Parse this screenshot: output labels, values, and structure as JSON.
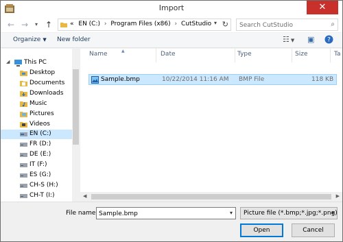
{
  "window": {
    "title": "Import",
    "close_glyph": "✕"
  },
  "navigation": {
    "back_icon": "arrow-left-icon",
    "forward_icon": "arrow-right-icon",
    "up_icon": "arrow-up-icon",
    "breadcrumb": {
      "overflow": "«",
      "parts": [
        "EN (C:)",
        "Program Files (x86)",
        "CutStudio"
      ],
      "separator": "›"
    },
    "search_placeholder": "Search CutStudio"
  },
  "toolbar": {
    "organize_label": "Organize",
    "new_folder_label": "New folder"
  },
  "nav_pane": {
    "items": [
      {
        "label": "This PC",
        "icon": "computer-icon"
      },
      {
        "label": "Desktop",
        "icon": "desktop-folder-icon"
      },
      {
        "label": "Documents",
        "icon": "documents-folder-icon"
      },
      {
        "label": "Downloads",
        "icon": "downloads-folder-icon"
      },
      {
        "label": "Music",
        "icon": "music-folder-icon"
      },
      {
        "label": "Pictures",
        "icon": "pictures-folder-icon"
      },
      {
        "label": "Videos",
        "icon": "videos-folder-icon"
      },
      {
        "label": "EN (C:)",
        "icon": "drive-icon",
        "selected": true
      },
      {
        "label": "FR (D:)",
        "icon": "drive-icon"
      },
      {
        "label": "DE (E:)",
        "icon": "drive-icon"
      },
      {
        "label": "IT (F:)",
        "icon": "drive-icon"
      },
      {
        "label": "ES (G:)",
        "icon": "drive-icon"
      },
      {
        "label": "CH-S (H:)",
        "icon": "drive-icon"
      },
      {
        "label": "CH-T (I:)",
        "icon": "drive-icon"
      }
    ]
  },
  "file_list": {
    "columns": [
      "Name",
      "Date",
      "Type",
      "Size",
      "Ta"
    ],
    "rows": [
      {
        "name": "Sample.bmp",
        "date": "10/22/2014 11:16 AM",
        "type": "BMP File",
        "size": "118 KB",
        "icon": "bitmap-file-icon"
      }
    ]
  },
  "footer": {
    "file_name_label": "File name:",
    "file_name_value": "Sample.bmp",
    "file_type_value": "Picture file (*.bmp;*.jpg;*.png)",
    "open_label": "Open",
    "cancel_label": "Cancel"
  },
  "colors": {
    "selection": "#cce8ff",
    "selection_border": "#99d1ff",
    "close": "#c7302b",
    "link": "#1e395b"
  }
}
